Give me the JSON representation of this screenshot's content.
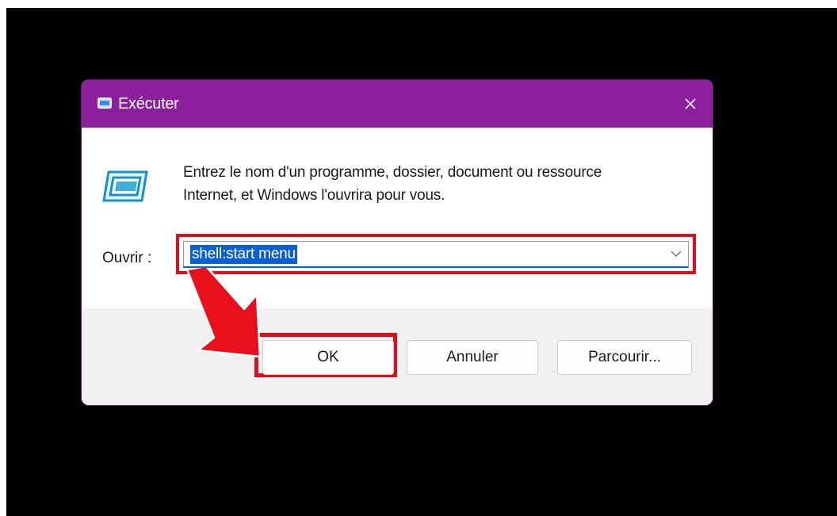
{
  "window": {
    "title": "Exécuter",
    "close_icon": "close-icon",
    "app_icon": "run-icon",
    "title_bar_color": "#8b1f9c"
  },
  "body": {
    "description": "Entrez le nom d'un programme, dossier, document ou ressource Internet, et Windows l'ouvrira pour vous.",
    "open_label": "Ouvrir :",
    "open_value": "shell:start menu",
    "selection_color": "#0a5fd4"
  },
  "buttons": {
    "ok": "OK",
    "cancel": "Annuler",
    "browse": "Parcourir..."
  },
  "annotations": {
    "highlight_color": "#d9101c",
    "arrow_icon": "red-arrow-icon"
  }
}
